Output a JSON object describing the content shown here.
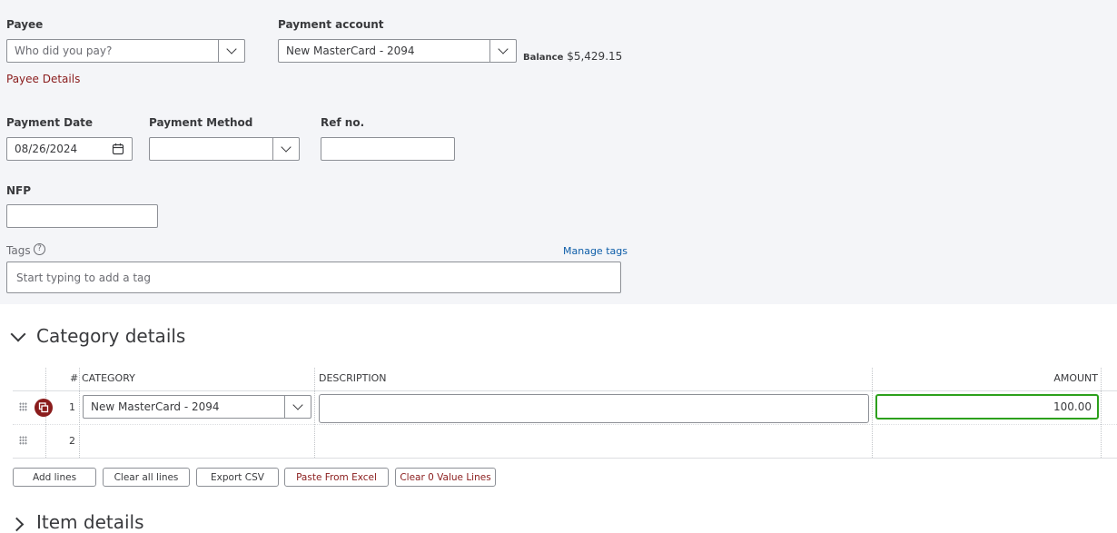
{
  "form": {
    "payee_label": "Payee",
    "payee_placeholder": "Who did you pay?",
    "payee_details_link": "Payee Details",
    "payment_account_label": "Payment account",
    "payment_account_value": "New MasterCard - 2094",
    "balance_label": "Balance",
    "balance_value": "$5,429.15",
    "payment_date_label": "Payment Date",
    "payment_date_value": "08/26/2024",
    "payment_method_label": "Payment Method",
    "payment_method_value": "",
    "ref_no_label": "Ref no.",
    "ref_no_value": "",
    "nfp_label": "NFP",
    "nfp_value": "",
    "tags_label": "Tags",
    "tags_help_glyph": "?",
    "manage_tags_link": "Manage tags",
    "tags_placeholder": "Start typing to add a tag"
  },
  "category_details": {
    "title": "Category details",
    "columns": {
      "num": "#",
      "category": "CATEGORY",
      "description": "DESCRIPTION",
      "amount": "AMOUNT"
    },
    "rows": [
      {
        "num": "1",
        "category": "New MasterCard - 2094",
        "description": "",
        "amount": "100.00"
      },
      {
        "num": "2",
        "category": "",
        "description": "",
        "amount": ""
      }
    ],
    "buttons": {
      "add_lines": "Add lines",
      "clear_all_lines": "Clear all lines",
      "export_csv": "Export CSV",
      "paste_from_excel": "Paste From Excel",
      "clear_zero_value_lines": "Clear 0 Value Lines"
    }
  },
  "item_details": {
    "title": "Item details"
  },
  "colors": {
    "accent_red": "#8a1c1c",
    "link_blue": "#0d5da8",
    "focus_green": "#2ca01c",
    "panel_bg": "#f4f5f8"
  }
}
